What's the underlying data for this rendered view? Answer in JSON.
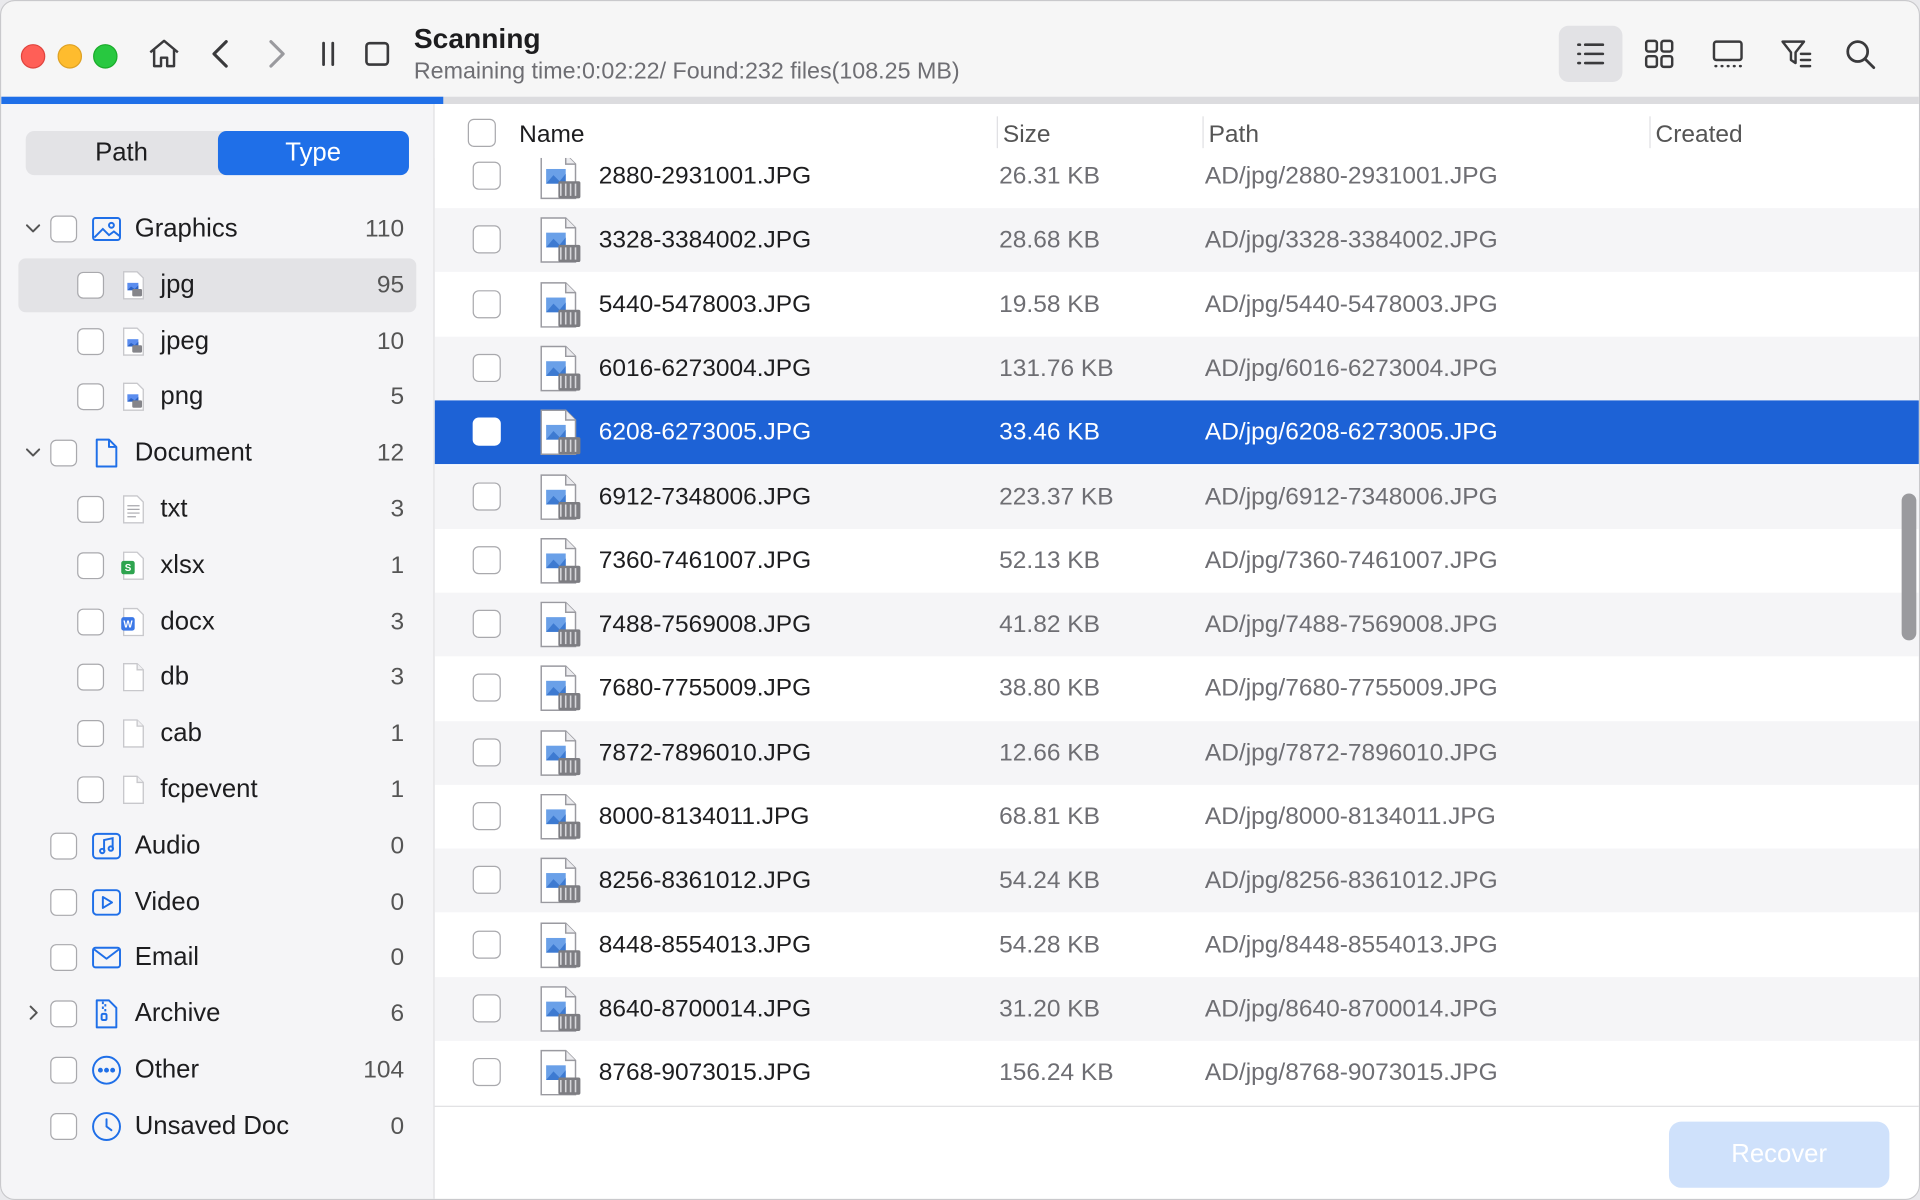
{
  "titlebar": {
    "title": "Scanning",
    "subtitle": "Remaining time:0:02:22/ Found:232 files(108.25 MB)",
    "progress_fraction": 0.23
  },
  "sidebar": {
    "tabs": [
      {
        "label": "Path",
        "active": false
      },
      {
        "label": "Type",
        "active": true
      }
    ],
    "items": [
      {
        "label": "Graphics",
        "count": "110",
        "icon": "image-icon",
        "level": 0,
        "chevron": "expanded"
      },
      {
        "label": "jpg",
        "count": "95",
        "icon": "jpg-file-icon",
        "level": 1,
        "selected": true
      },
      {
        "label": "jpeg",
        "count": "10",
        "icon": "jpeg-file-icon",
        "level": 1
      },
      {
        "label": "png",
        "count": "5",
        "icon": "png-file-icon",
        "level": 1
      },
      {
        "label": "Document",
        "count": "12",
        "icon": "document-icon",
        "level": 0,
        "chevron": "expanded"
      },
      {
        "label": "txt",
        "count": "3",
        "icon": "txt-file-icon",
        "level": 1
      },
      {
        "label": "xlsx",
        "count": "1",
        "icon": "xlsx-file-icon",
        "level": 1
      },
      {
        "label": "docx",
        "count": "3",
        "icon": "docx-file-icon",
        "level": 1
      },
      {
        "label": "db",
        "count": "3",
        "icon": "blank-file-icon",
        "level": 1
      },
      {
        "label": "cab",
        "count": "1",
        "icon": "blank-file-icon",
        "level": 1
      },
      {
        "label": "fcpevent",
        "count": "1",
        "icon": "blank-file-icon",
        "level": 1
      },
      {
        "label": "Audio",
        "count": "0",
        "icon": "audio-icon",
        "level": 0
      },
      {
        "label": "Video",
        "count": "0",
        "icon": "video-icon",
        "level": 0
      },
      {
        "label": "Email",
        "count": "0",
        "icon": "email-icon",
        "level": 0
      },
      {
        "label": "Archive",
        "count": "6",
        "icon": "archive-icon",
        "level": 0,
        "chevron": "collapsed"
      },
      {
        "label": "Other",
        "count": "104",
        "icon": "other-icon",
        "level": 0
      },
      {
        "label": "Unsaved Doc",
        "count": "0",
        "icon": "clock-icon",
        "level": 0
      }
    ]
  },
  "table": {
    "columns": [
      "Name",
      "Size",
      "Path",
      "Created"
    ],
    "rows": [
      {
        "name": "2880-2931001.JPG",
        "size": "26.31 KB",
        "path": "AD/jpg/2880-2931001.JPG"
      },
      {
        "name": "3328-3384002.JPG",
        "size": "28.68 KB",
        "path": "AD/jpg/3328-3384002.JPG"
      },
      {
        "name": "5440-5478003.JPG",
        "size": "19.58 KB",
        "path": "AD/jpg/5440-5478003.JPG"
      },
      {
        "name": "6016-6273004.JPG",
        "size": "131.76 KB",
        "path": "AD/jpg/6016-6273004.JPG"
      },
      {
        "name": "6208-6273005.JPG",
        "size": "33.46 KB",
        "path": "AD/jpg/6208-6273005.JPG",
        "selected": true
      },
      {
        "name": "6912-7348006.JPG",
        "size": "223.37 KB",
        "path": "AD/jpg/6912-7348006.JPG"
      },
      {
        "name": "7360-7461007.JPG",
        "size": "52.13 KB",
        "path": "AD/jpg/7360-7461007.JPG"
      },
      {
        "name": "7488-7569008.JPG",
        "size": "41.82 KB",
        "path": "AD/jpg/7488-7569008.JPG"
      },
      {
        "name": "7680-7755009.JPG",
        "size": "38.80 KB",
        "path": "AD/jpg/7680-7755009.JPG"
      },
      {
        "name": "7872-7896010.JPG",
        "size": "12.66 KB",
        "path": "AD/jpg/7872-7896010.JPG"
      },
      {
        "name": "8000-8134011.JPG",
        "size": "68.81 KB",
        "path": "AD/jpg/8000-8134011.JPG"
      },
      {
        "name": "8256-8361012.JPG",
        "size": "54.24 KB",
        "path": "AD/jpg/8256-8361012.JPG"
      },
      {
        "name": "8448-8554013.JPG",
        "size": "54.28 KB",
        "path": "AD/jpg/8448-8554013.JPG"
      },
      {
        "name": "8640-8700014.JPG",
        "size": "31.20 KB",
        "path": "AD/jpg/8640-8700014.JPG"
      },
      {
        "name": "8768-9073015.JPG",
        "size": "156.24 KB",
        "path": "AD/jpg/8768-9073015.JPG"
      }
    ]
  },
  "footer": {
    "recover_label": "Recover",
    "recover_enabled": false
  },
  "colors": {
    "accent": "#1f6fe8",
    "selection": "#1d62d6"
  }
}
